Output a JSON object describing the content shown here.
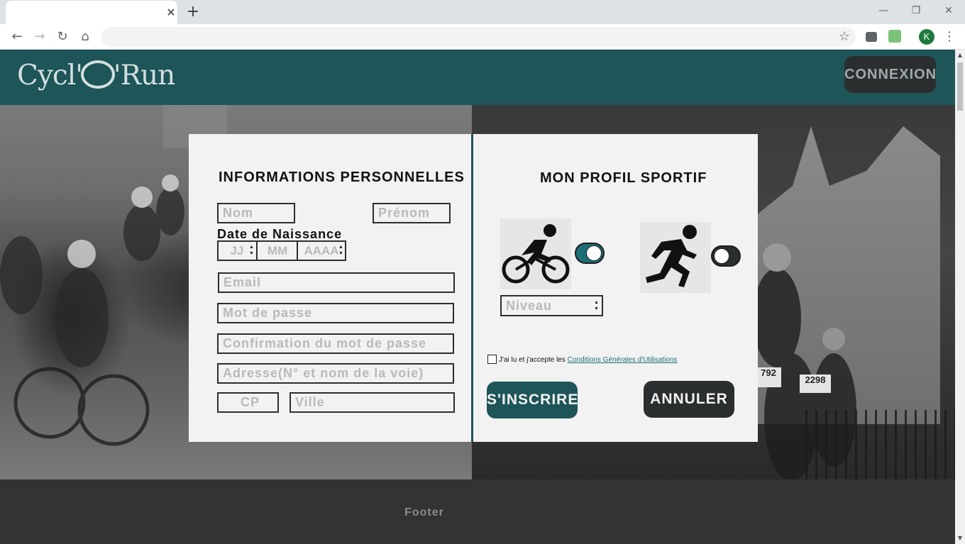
{
  "browser": {
    "tab_close_glyph": "✕",
    "new_tab_glyph": "+",
    "window_controls": [
      "—",
      "❐",
      "✕"
    ],
    "back_glyph": "←",
    "forward_glyph": "→",
    "reload_glyph": "↻",
    "home_glyph": "⌂",
    "address": "",
    "bookmark_glyph": "☆",
    "profile_initial": "K",
    "menu_glyph": "⋮"
  },
  "header": {
    "logo_left": "Cycl'",
    "logo_right": "'Run",
    "connexion_label": "CONNEXION"
  },
  "personal": {
    "title": "INFORMATIONS PERSONNELLES",
    "nom_placeholder": "Nom",
    "prenom_placeholder": "Prénom",
    "dob_label": "Date de Naissance",
    "dob_day": "JJ",
    "dob_month": "MM",
    "dob_year": "AAAA",
    "email_placeholder": "Email",
    "password_placeholder": "Mot de passe",
    "confirm_placeholder": "Confirmation du mot de passe",
    "address_placeholder": "Adresse(N° et nom de la voie)",
    "cp_placeholder": "CP",
    "ville_placeholder": "Ville"
  },
  "sport": {
    "title": "MON PROFIL SPORTIF",
    "cycling_icon": "cyclist-icon",
    "running_icon": "runner-icon",
    "cycling_enabled": true,
    "running_enabled": false,
    "niveau_label": "Niveau",
    "cgu_prefix": "J'ai lu et j'accepte les ",
    "cgu_link": "Conditions Générales d'Utilisations",
    "inscrire_label": "S'INSCRIRE",
    "annuler_label": "ANNULER"
  },
  "hero": {
    "bib_left": "792",
    "bib_right": "2298"
  },
  "footer": {
    "text": "Footer"
  },
  "colors": {
    "brand_teal": "#1d5559",
    "toggle_on": "#1d6e74",
    "dark_button": "#2b2e2f",
    "footer_bg": "#333333"
  }
}
